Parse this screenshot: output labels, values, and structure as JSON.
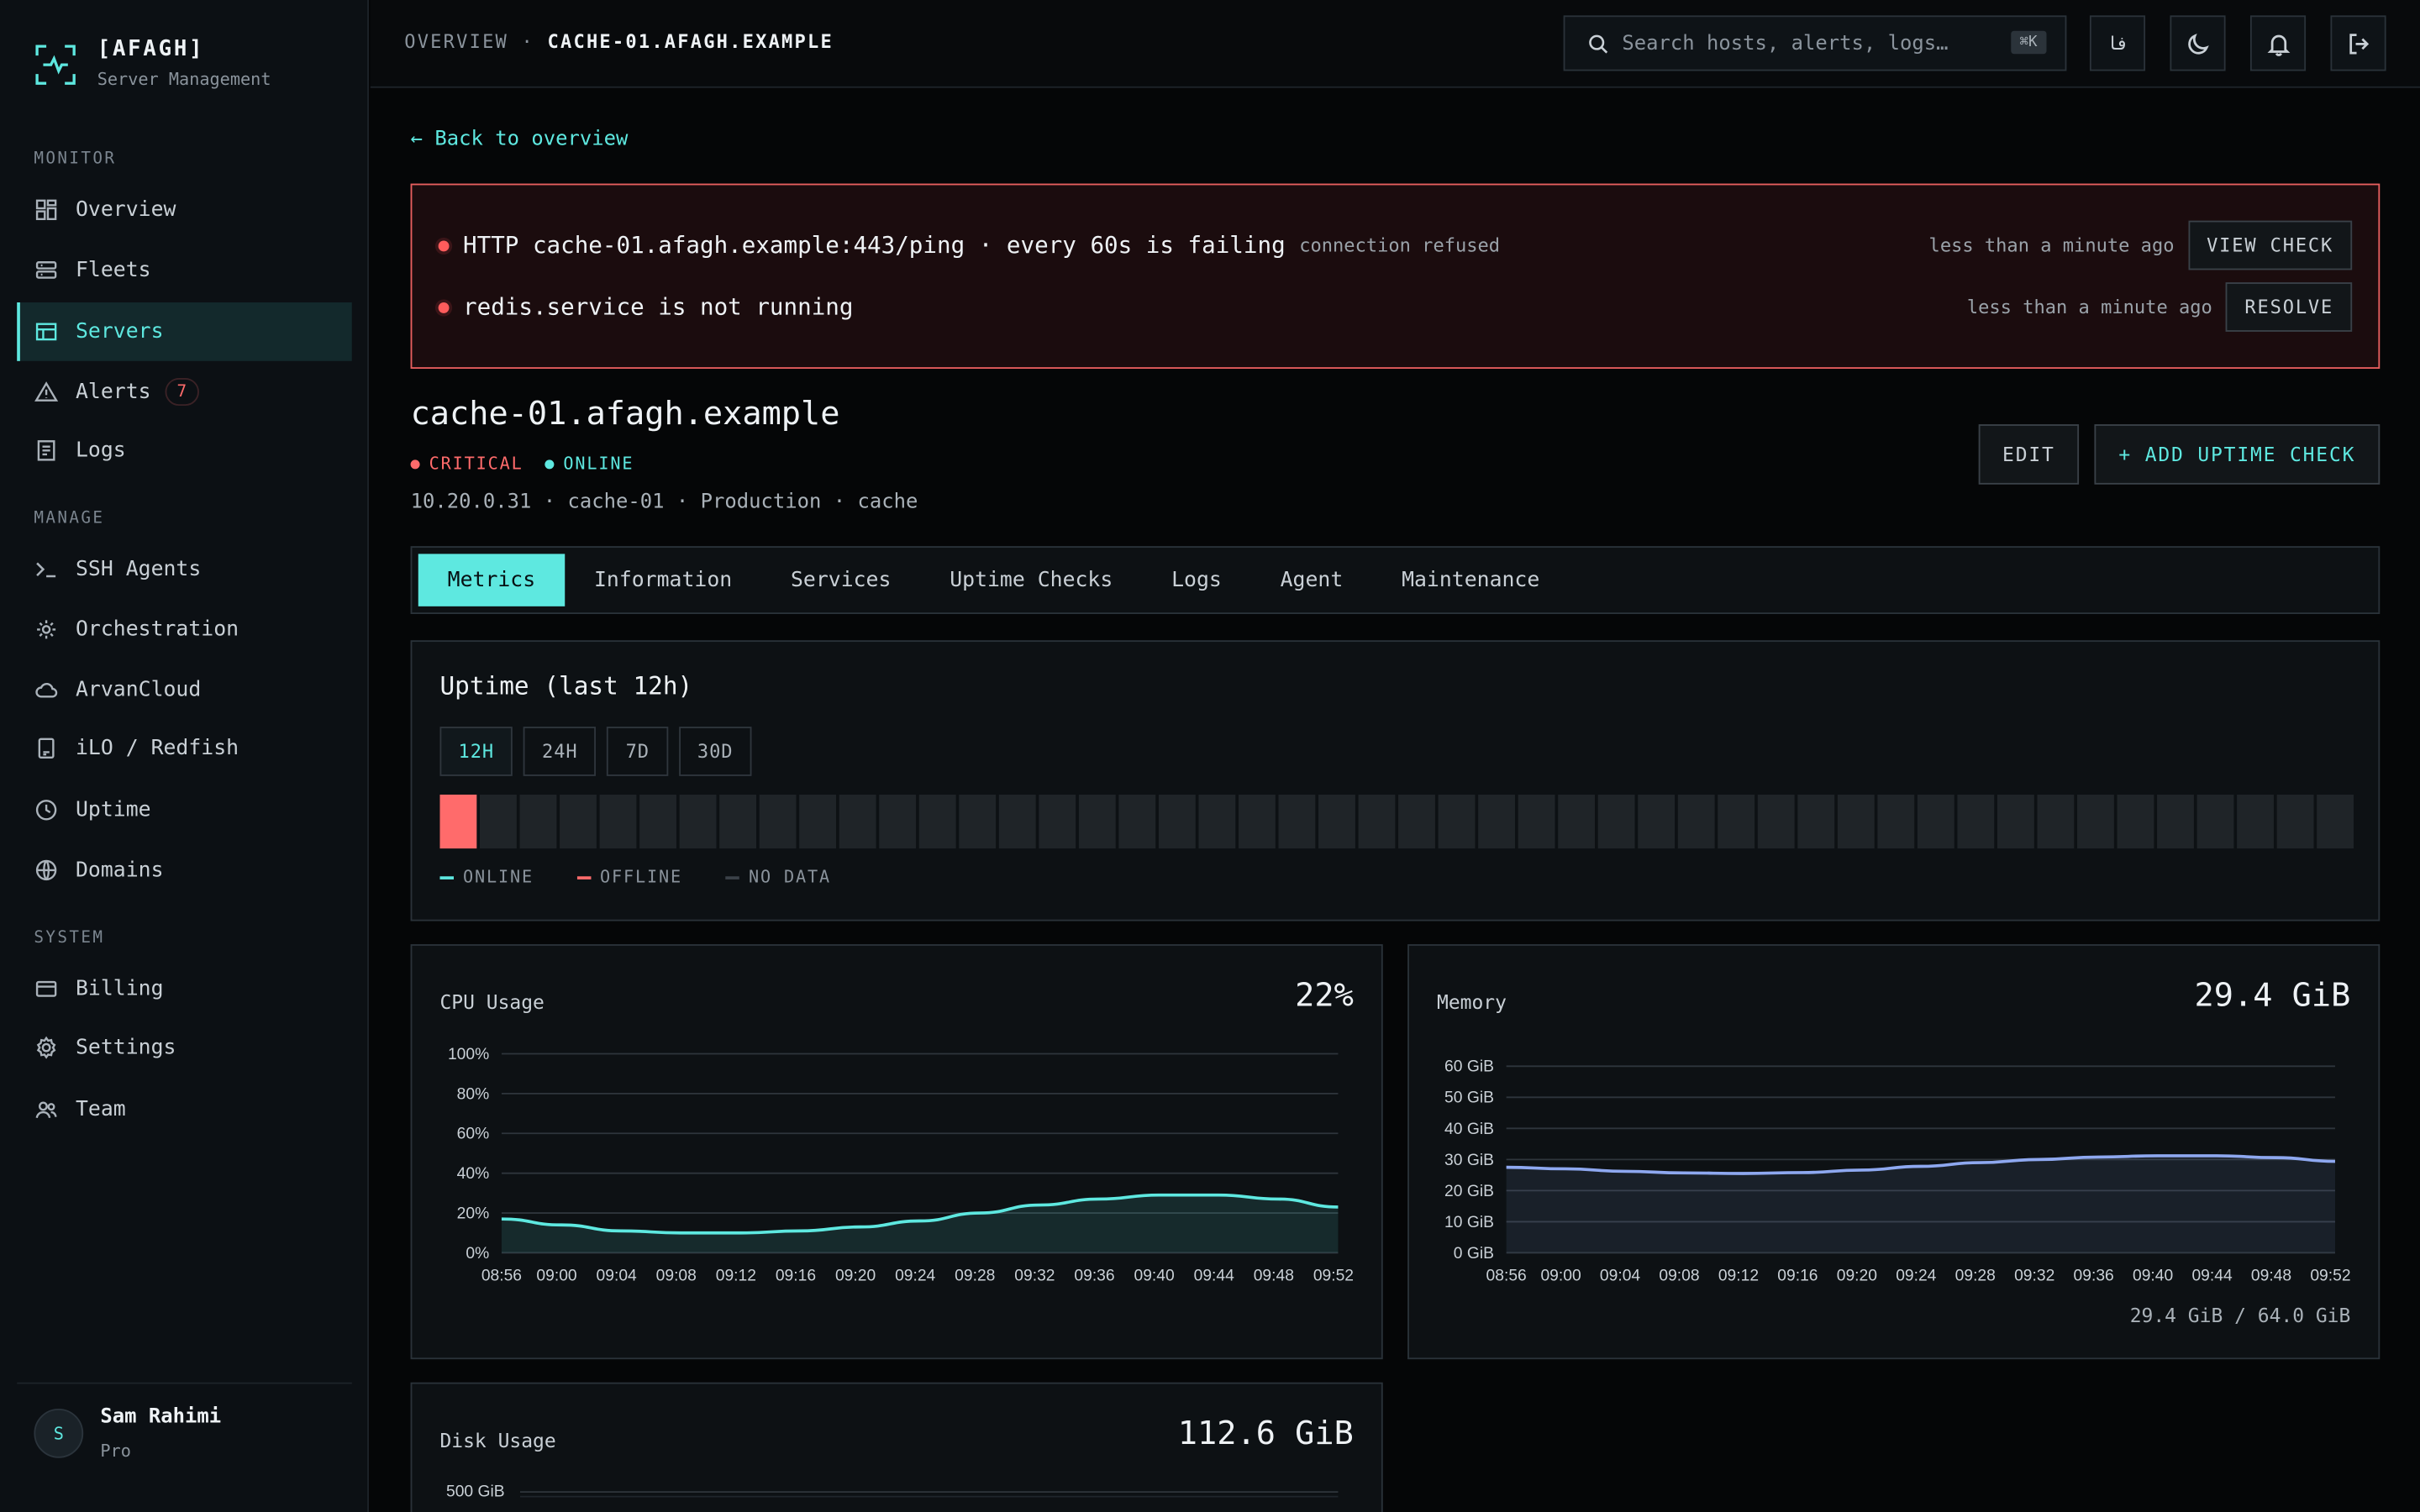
{
  "brand": {
    "name": "[AFAGH]",
    "subtitle": "Server Management"
  },
  "sidebar": {
    "sections": [
      "MONITOR",
      "MANAGE",
      "SYSTEM"
    ],
    "items": [
      {
        "label": "Overview",
        "icon": "grid-icon"
      },
      {
        "label": "Fleets",
        "icon": "server-stack-icon"
      },
      {
        "label": "Servers",
        "icon": "table-icon",
        "active": true
      },
      {
        "label": "Alerts",
        "icon": "warning-icon",
        "badge": "7"
      },
      {
        "label": "Logs",
        "icon": "document-icon"
      },
      {
        "label": "SSH Agents",
        "icon": "terminal-icon"
      },
      {
        "label": "Orchestration",
        "icon": "gear-nodes-icon"
      },
      {
        "label": "ArvanCloud",
        "icon": "cloud-icon"
      },
      {
        "label": "iLO / Redfish",
        "icon": "device-icon"
      },
      {
        "label": "Uptime",
        "icon": "clock-icon"
      },
      {
        "label": "Domains",
        "icon": "globe-icon"
      },
      {
        "label": "Billing",
        "icon": "credit-card-icon"
      },
      {
        "label": "Settings",
        "icon": "gear-icon"
      },
      {
        "label": "Team",
        "icon": "users-icon"
      }
    ],
    "user": {
      "initial": "S",
      "name": "Sam Rahimi",
      "plan": "Pro"
    }
  },
  "topbar": {
    "breadcrumb_root": "OVERVIEW",
    "breadcrumb_sep": "·",
    "breadcrumb_current": "CACHE-01.AFAGH.EXAMPLE",
    "search_placeholder": "Search hosts, alerts, logs…",
    "search_shortcut": "⌘K",
    "lang_label": "فا"
  },
  "back_link": "← Back to overview",
  "alerts": [
    {
      "text": "HTTP cache-01.afagh.example:443/ping · every 60s is failing",
      "detail": "connection refused",
      "time": "less than a minute ago",
      "action": "VIEW CHECK"
    },
    {
      "text": "redis.service is not running",
      "detail": "",
      "time": "less than a minute ago",
      "action": "RESOLVE"
    }
  ],
  "server": {
    "hostname": "cache-01.afagh.example",
    "severity": "CRITICAL",
    "status": "ONLINE",
    "meta": "10.20.0.31 · cache-01 · Production · cache",
    "edit_label": "EDIT",
    "add_check_label": "+ ADD UPTIME CHECK"
  },
  "tabs": [
    "Metrics",
    "Information",
    "Services",
    "Uptime Checks",
    "Logs",
    "Agent",
    "Maintenance"
  ],
  "uptime": {
    "title": "Uptime (last 12h)",
    "ranges": [
      "12H",
      "24H",
      "7D",
      "30D"
    ],
    "active_range": "12H",
    "slots": [
      "offline",
      "none",
      "none",
      "none",
      "none",
      "none",
      "none",
      "none",
      "none",
      "none",
      "none",
      "none",
      "none",
      "none",
      "none",
      "none",
      "none",
      "none",
      "none",
      "none",
      "none",
      "none",
      "none",
      "none",
      "none",
      "none",
      "none",
      "none",
      "none",
      "none",
      "none",
      "none",
      "none",
      "none",
      "none",
      "none",
      "none",
      "none",
      "none",
      "none",
      "none",
      "none",
      "none",
      "none",
      "none",
      "none",
      "none",
      "none"
    ],
    "legend": [
      {
        "label": "ONLINE",
        "color": "#5ee8e0"
      },
      {
        "label": "OFFLINE",
        "color": "#ff6b6b"
      },
      {
        "label": "NO DATA",
        "color": "#3a4148"
      }
    ]
  },
  "colors": {
    "accent": "#5ee8e0",
    "critical": "#ff6b6b",
    "memory": "#8ea8f0"
  },
  "cpu": {
    "title": "CPU Usage",
    "value": "22%",
    "chart_data": {
      "type": "area",
      "x": [
        "08:56",
        "09:00",
        "09:04",
        "09:08",
        "09:12",
        "09:16",
        "09:20",
        "09:24",
        "09:28",
        "09:32",
        "09:36",
        "09:40",
        "09:44",
        "09:48",
        "09:52"
      ],
      "y_ticks": [
        "0%",
        "20%",
        "40%",
        "60%",
        "80%",
        "100%"
      ],
      "ylim": [
        0,
        100
      ],
      "series": [
        {
          "values": [
            17,
            14,
            11,
            10,
            10,
            11,
            13,
            16,
            20,
            24,
            27,
            29,
            29,
            27,
            23
          ]
        }
      ]
    }
  },
  "memory": {
    "title": "Memory",
    "value": "29.4 GiB",
    "footer": "29.4 GiB / 64.0 GiB",
    "chart_data": {
      "type": "area",
      "x": [
        "08:56",
        "09:00",
        "09:04",
        "09:08",
        "09:12",
        "09:16",
        "09:20",
        "09:24",
        "09:28",
        "09:32",
        "09:36",
        "09:40",
        "09:44",
        "09:48",
        "09:52"
      ],
      "y_ticks": [
        "0 GiB",
        "10 GiB",
        "20 GiB",
        "30 GiB",
        "40 GiB",
        "50 GiB",
        "60 GiB"
      ],
      "ylim": [
        0,
        64
      ],
      "series": [
        {
          "values": [
            27.5,
            27,
            26.2,
            25.7,
            25.5,
            25.8,
            26.6,
            27.8,
            29,
            30,
            30.8,
            31.2,
            31.2,
            30.6,
            29.4
          ]
        }
      ]
    }
  },
  "disk": {
    "title": "Disk Usage",
    "value": "112.6 GiB",
    "first_tick": "500 GiB"
  }
}
